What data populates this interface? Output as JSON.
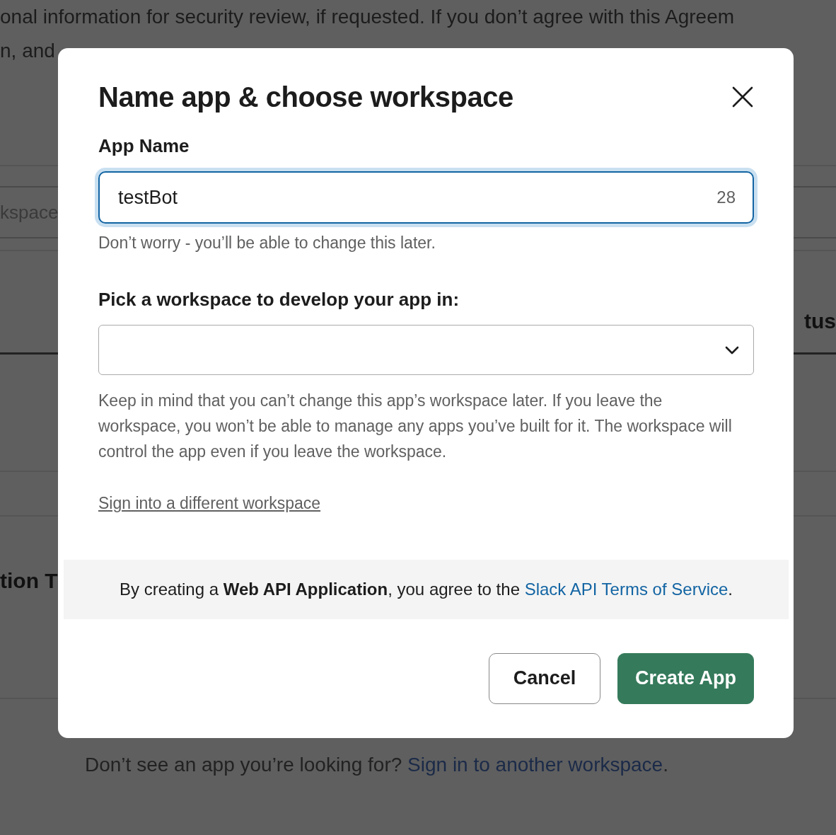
{
  "background_page": {
    "text_lines": [
      "onal information for security review, if requested. If you don’t agree with this Agreem",
      "n, and"
    ],
    "field_fragment": "kspace",
    "column_heading_fragment": "tus",
    "section_heading_fragment": "tion T",
    "footer_note": {
      "text": "Don’t see an app you’re looking for? ",
      "link": "Sign in to another workspace",
      "after": "."
    }
  },
  "dialog": {
    "title": "Name app & choose workspace",
    "app_name": {
      "label": "App Name",
      "value": "testBot",
      "counter": "28",
      "focused": true,
      "hint": "Don’t worry - you’ll be able to change this later."
    },
    "workspace": {
      "label": "Pick a workspace to develop your app in:",
      "note": "Keep in mind that you can’t change this app’s workspace later. If you leave the workspace, you won’t be able to manage any apps you’ve built for it. The workspace will control the app even if you leave the workspace."
    },
    "switch_link": "Sign into a different workspace",
    "terms": {
      "text": "By creating a **Web API Application**, you agree to the ",
      "link": "Slack API Terms of Service",
      "after": "."
    },
    "buttons": [
      {
        "label": "Cancel",
        "kind": "secondary"
      },
      {
        "label": "Create App",
        "kind": "primary"
      }
    ]
  }
}
